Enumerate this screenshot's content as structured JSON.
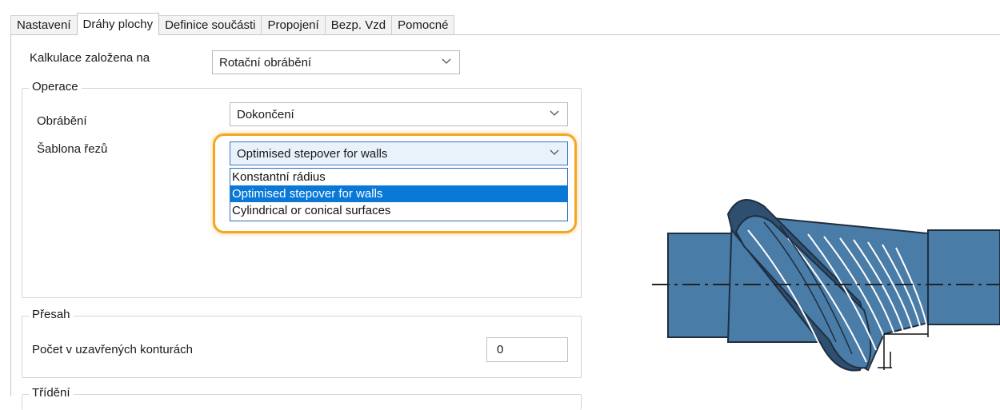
{
  "tabs": [
    {
      "label": "Nastavení"
    },
    {
      "label": "Dráhy plochy"
    },
    {
      "label": "Definice součásti"
    },
    {
      "label": "Propojení"
    },
    {
      "label": "Bezp. Vzd"
    },
    {
      "label": "Pomocné"
    }
  ],
  "active_tab_index": 1,
  "calc": {
    "label": "Kalkulace založena na",
    "value": "Rotační obrábění"
  },
  "operace": {
    "legend": "Operace",
    "machining_label": "Obrábění",
    "machining_value": "Dokončení",
    "pattern_label": "Šablona řezů",
    "pattern_value": "Optimised stepover for walls",
    "pattern_options": [
      "Konstantní rádius",
      "Optimised stepover for walls",
      "Cylindrical or conical surfaces"
    ],
    "pattern_selected_index": 1
  },
  "presah": {
    "legend": "Přesah",
    "closed_count_label": "Počet v uzavřených konturách",
    "closed_count_value": "0"
  },
  "trideni": {
    "legend": "Třídění"
  },
  "colors": {
    "accent_highlight": "#f5a623",
    "selection_blue": "#0a78d7",
    "part_blue": "#4a7ca8",
    "part_dark": "#2f4f70"
  },
  "icons": {
    "dropdown": "chevron-down-icon",
    "illustration": "toolpath-illustration-icon"
  }
}
